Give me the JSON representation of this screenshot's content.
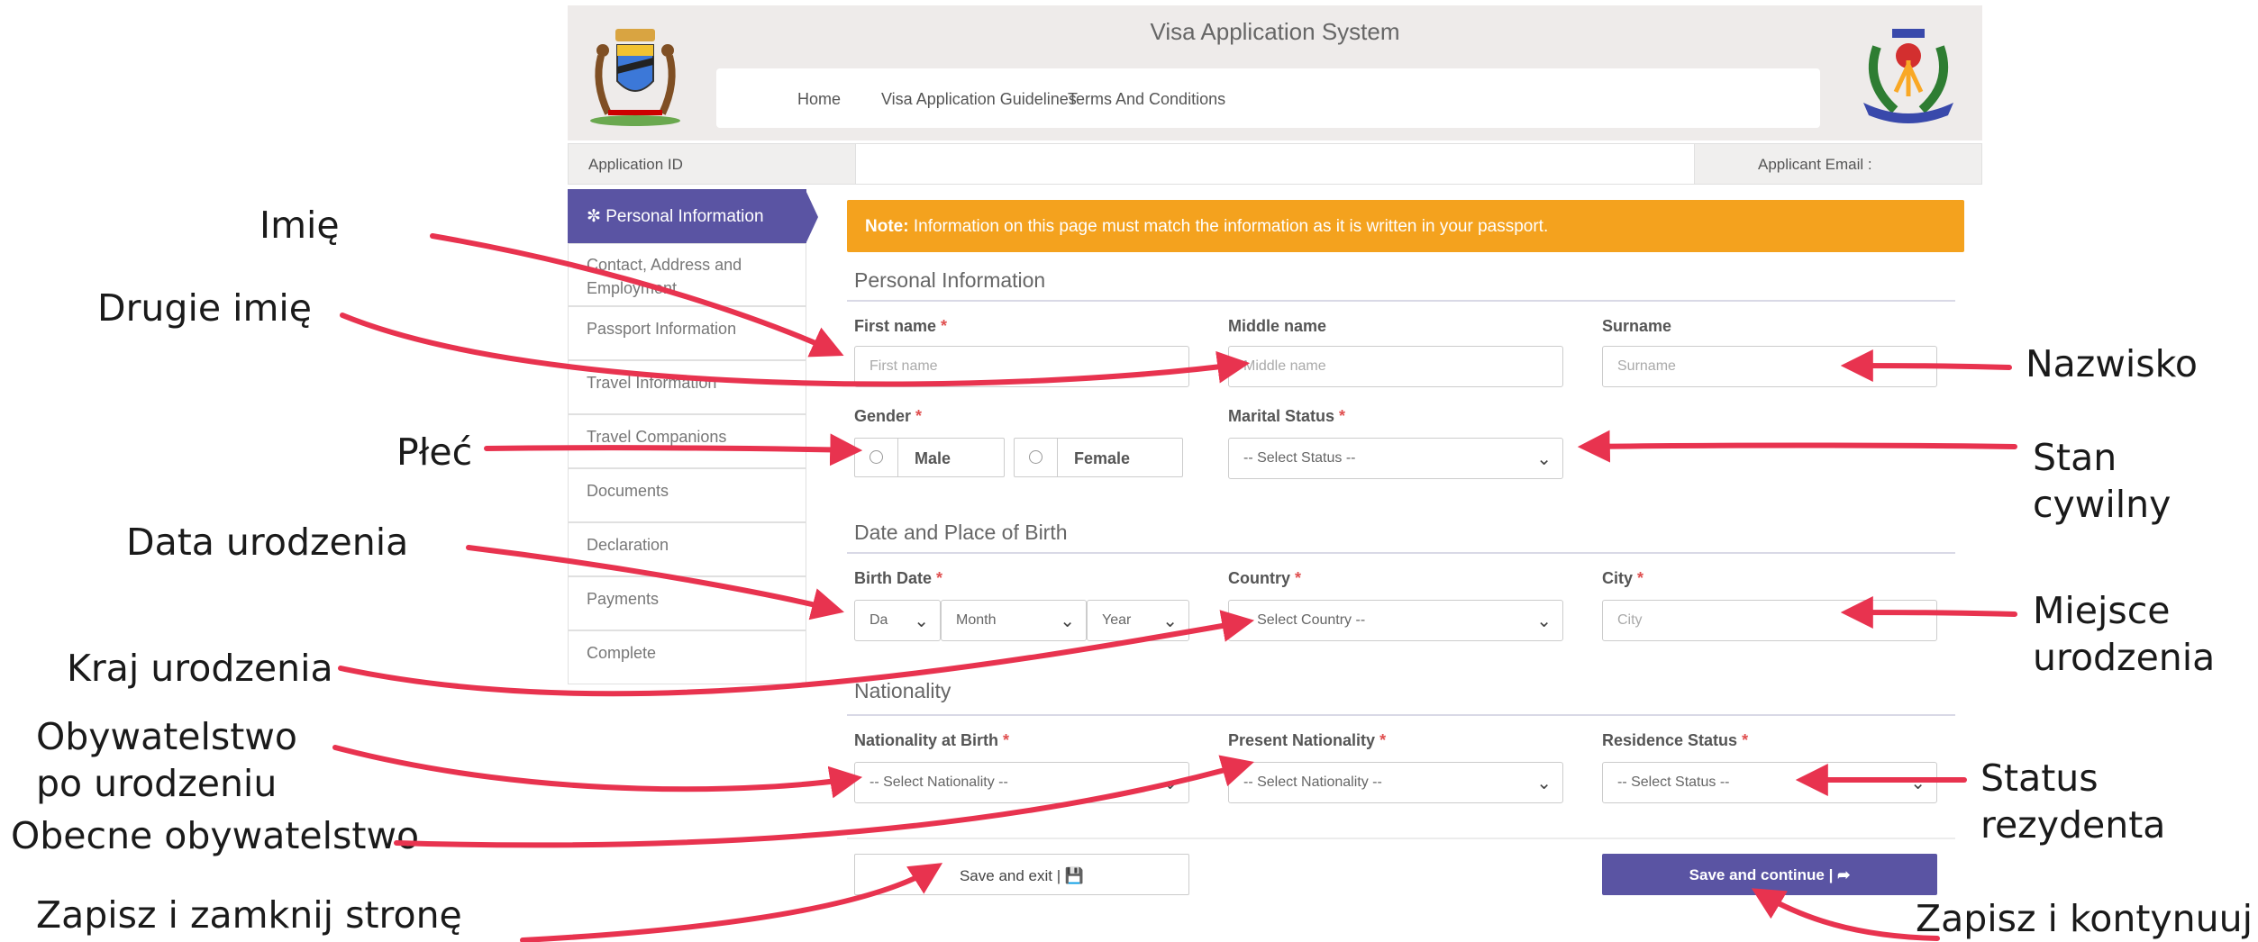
{
  "app": {
    "title": "Visa Application System",
    "nav": [
      "Home",
      "Visa Application Guidelines",
      "Terms And Conditions"
    ],
    "application_id_label": "Application ID",
    "applicant_email_label": "Applicant Email :"
  },
  "sidebar": {
    "items": [
      {
        "label": "Personal Information",
        "active": true
      },
      {
        "label": "Contact, Address and Employment"
      },
      {
        "label": "Passport Information"
      },
      {
        "label": "Travel Information"
      },
      {
        "label": "Travel Companions"
      },
      {
        "label": "Documents"
      },
      {
        "label": "Declaration"
      },
      {
        "label": "Payments"
      },
      {
        "label": "Complete"
      }
    ],
    "active_icon": "spinner-icon"
  },
  "note": {
    "prefix": "Note:",
    "text": "Information on this page must match the information as it is written in your passport."
  },
  "sections": {
    "personal": "Personal Information",
    "birth": "Date and Place of Birth",
    "nationality": "Nationality"
  },
  "fields": {
    "first_name": {
      "label": "First name",
      "placeholder": "First name"
    },
    "middle_name": {
      "label": "Middle name",
      "placeholder": "Middle name"
    },
    "surname": {
      "label": "Surname",
      "placeholder": "Surname"
    },
    "gender": {
      "label": "Gender",
      "options": [
        "Male",
        "Female"
      ]
    },
    "marital_status": {
      "label": "Marital Status",
      "value": "-- Select Status --"
    },
    "birth_date": {
      "label": "Birth Date",
      "day": "Da",
      "month": "Month",
      "year": "Year"
    },
    "country": {
      "label": "Country",
      "value": "-- Select Country --"
    },
    "city": {
      "label": "City",
      "placeholder": "City"
    },
    "nationality_birth": {
      "label": "Nationality at Birth",
      "value": "-- Select Nationality --"
    },
    "present_nationality": {
      "label": "Present Nationality",
      "value": "-- Select Nationality --"
    },
    "residence_status": {
      "label": "Residence Status",
      "value": "-- Select Status --"
    },
    "required_mark": "*"
  },
  "buttons": {
    "save_exit": "Save and exit | 💾",
    "save_continue": "Save and continue | ➦"
  },
  "annotations": {
    "imie": "Imię",
    "drugie_imie": "Drugie imię",
    "plec": "Płeć",
    "data_urodzenia": "Data urodzenia",
    "kraj_urodzenia": "Kraj urodzenia",
    "obywatelstwo_line1": "Obywatelstwo",
    "obywatelstwo_line2": "po urodzeniu",
    "obecne_obywatelstwo": "Obecne obywatelstwo",
    "zapisz_zamknij": "Zapisz i zamknij stronę",
    "nazwisko": "Nazwisko",
    "stan_line1": "Stan",
    "stan_line2": "cywilny",
    "miejsce_line1": "Miejsce",
    "miejsce_line2": "urodzenia",
    "status_line1": "Status",
    "status_line2": "rezydenta",
    "zapisz_kontynuuj": "Zapisz i kontynuuj"
  },
  "colors": {
    "accent": "#5a54a3",
    "note": "#f4a21e",
    "arrow": "#e8334f"
  }
}
